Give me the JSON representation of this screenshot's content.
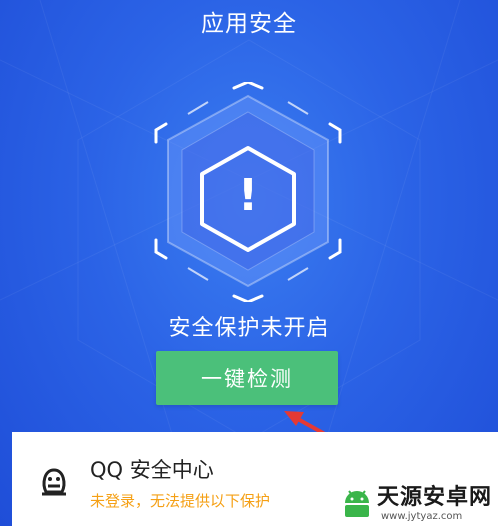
{
  "header": {
    "title": "应用安全"
  },
  "shield": {
    "icon": "warning-hexagon-icon",
    "symbol": "!"
  },
  "status": {
    "text": "安全保护未开启"
  },
  "action": {
    "scan_label": "一键检测"
  },
  "card": {
    "icon": "qq-penguin-icon",
    "title": "QQ 安全中心",
    "subtitle": "未登录，无法提供以下保护"
  },
  "watermark": {
    "name": "天源安卓网",
    "url": "www.jytyaz.com"
  },
  "colors": {
    "background": "#2b63e6",
    "button": "#4bc07a",
    "warning_text": "#f5a015",
    "arrow": "#e53935"
  }
}
